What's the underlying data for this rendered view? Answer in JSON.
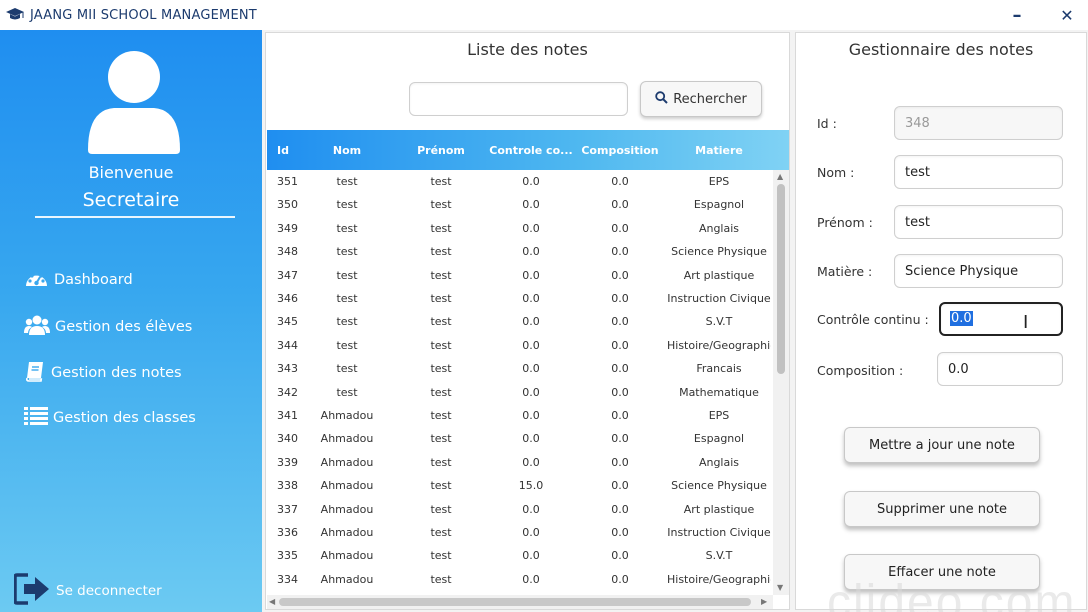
{
  "window": {
    "title": "JAANG MII SCHOOL MANAGEMENT",
    "minimize_symbol": "–",
    "close_symbol": "✕",
    "icon": "graduation-cap-icon"
  },
  "sidebar": {
    "welcome": "Bienvenue",
    "role": "Secretaire",
    "items": [
      {
        "label": "Dashboard",
        "icon": "dashboard-gauge-icon"
      },
      {
        "label": "Gestion des élèves",
        "icon": "users-icon"
      },
      {
        "label": "Gestion des notes",
        "icon": "book-icon"
      },
      {
        "label": "Gestion des classes",
        "icon": "list-icon"
      }
    ],
    "logout_label": "Se deconnecter",
    "colors": {
      "gradient_top": "#1f8ef0",
      "gradient_bottom": "#6ccaf2"
    }
  },
  "list": {
    "title": "Liste des notes",
    "search_value": "",
    "search_button": "Rechercher",
    "columns": [
      "Id",
      "Nom",
      "Prénom",
      "Controle co...",
      "Composition",
      "Matiere"
    ],
    "rows": [
      [
        "351",
        "test",
        "test",
        "0.0",
        "0.0",
        "EPS"
      ],
      [
        "350",
        "test",
        "test",
        "0.0",
        "0.0",
        "Espagnol"
      ],
      [
        "349",
        "test",
        "test",
        "0.0",
        "0.0",
        "Anglais"
      ],
      [
        "348",
        "test",
        "test",
        "0.0",
        "0.0",
        "Science Physique"
      ],
      [
        "347",
        "test",
        "test",
        "0.0",
        "0.0",
        "Art plastique"
      ],
      [
        "346",
        "test",
        "test",
        "0.0",
        "0.0",
        "Instruction Civique"
      ],
      [
        "345",
        "test",
        "test",
        "0.0",
        "0.0",
        "S.V.T"
      ],
      [
        "344",
        "test",
        "test",
        "0.0",
        "0.0",
        "Histoire/Geographie"
      ],
      [
        "343",
        "test",
        "test",
        "0.0",
        "0.0",
        "Francais"
      ],
      [
        "342",
        "test",
        "test",
        "0.0",
        "0.0",
        "Mathematique"
      ],
      [
        "341",
        "Ahmadou",
        "test",
        "0.0",
        "0.0",
        "EPS"
      ],
      [
        "340",
        "Ahmadou",
        "test",
        "0.0",
        "0.0",
        "Espagnol"
      ],
      [
        "339",
        "Ahmadou",
        "test",
        "0.0",
        "0.0",
        "Anglais"
      ],
      [
        "338",
        "Ahmadou",
        "test",
        "15.0",
        "0.0",
        "Science Physique"
      ],
      [
        "337",
        "Ahmadou",
        "test",
        "0.0",
        "0.0",
        "Art plastique"
      ],
      [
        "336",
        "Ahmadou",
        "test",
        "0.0",
        "0.0",
        "Instruction Civique"
      ],
      [
        "335",
        "Ahmadou",
        "test",
        "0.0",
        "0.0",
        "S.V.T"
      ],
      [
        "334",
        "Ahmadou",
        "test",
        "0.0",
        "0.0",
        "Histoire/Geographie"
      ]
    ],
    "header_colors": {
      "start": "#1f8ef0",
      "end": "#80d2f4"
    }
  },
  "form": {
    "title": "Gestionnaire des notes",
    "fields": {
      "id": {
        "label": "Id :",
        "value": "348"
      },
      "nom": {
        "label": "Nom :",
        "value": "test"
      },
      "prenom": {
        "label": "Prénom :",
        "value": "test"
      },
      "matiere": {
        "label": "Matière :",
        "value": "Science Physique"
      },
      "controle": {
        "label": "Contrôle continu :",
        "value": "0.0"
      },
      "composition": {
        "label": "Composition :",
        "value": "0.0"
      }
    },
    "buttons": {
      "update": "Mettre a jour une note",
      "delete": "Supprimer une note",
      "clear": "Effacer une note"
    }
  },
  "watermark": "clideo.com"
}
